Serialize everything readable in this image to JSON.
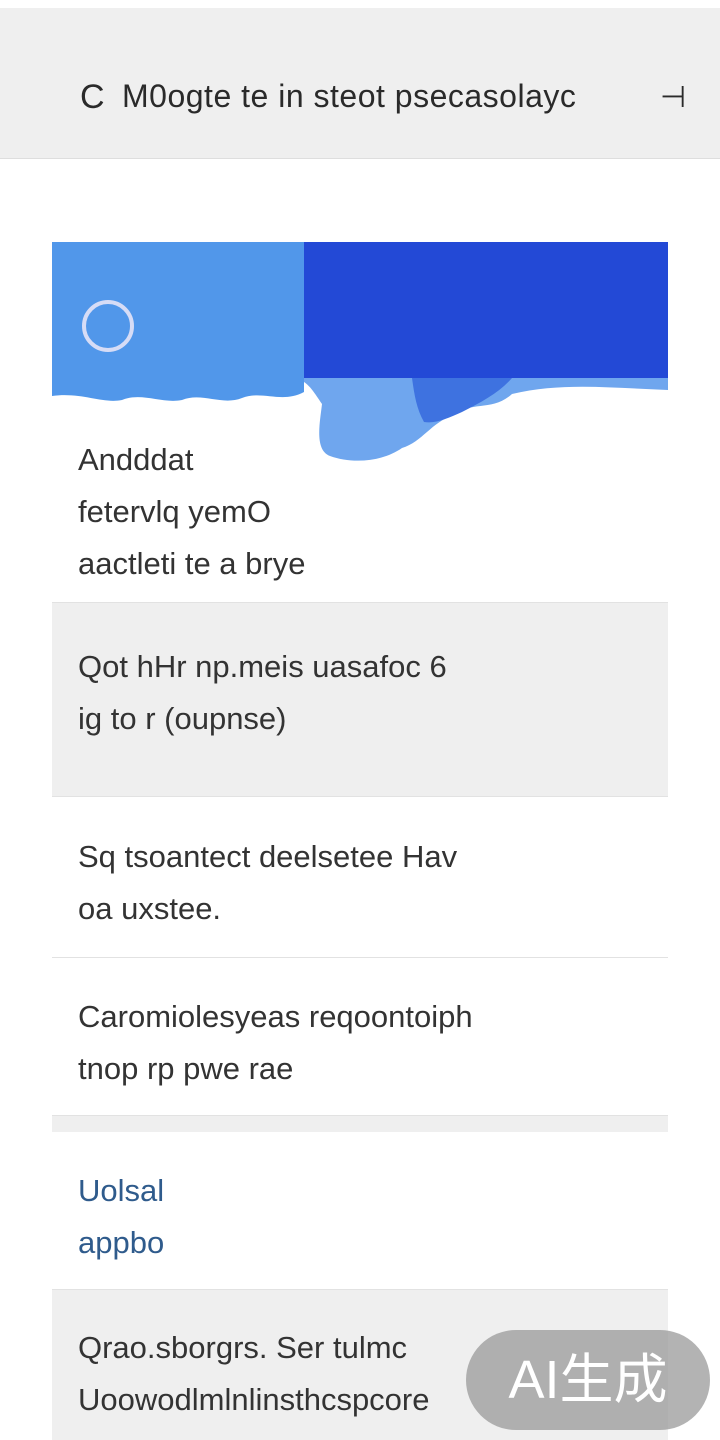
{
  "header": {
    "back_glyph": "C",
    "title": "M0ogte te in steot psecaѕolayc",
    "more_glyph": "⊣"
  },
  "hero": {
    "text": "Andddat\nfetervlq yemO\naactleti te a brye",
    "colors": {
      "band_left": "#5197ea",
      "band_right": "#2349d6"
    }
  },
  "items": [
    {
      "text": "Qot hHr np.meis uasafoc 6\nig to r (oupnse)"
    },
    {
      "text": "Sq tsoantect deelsetee Hav\noa uxstee."
    },
    {
      "text": "Caromiolesyeas reqoontoiph\ntnop rp pwe rae"
    },
    {
      "text": "Uolsal\nappbo"
    },
    {
      "text": "Qrao.sborgrs. Ser tulmc\nUoowodlmlnlinsthcspcore"
    }
  ],
  "watermark": "AI生成"
}
